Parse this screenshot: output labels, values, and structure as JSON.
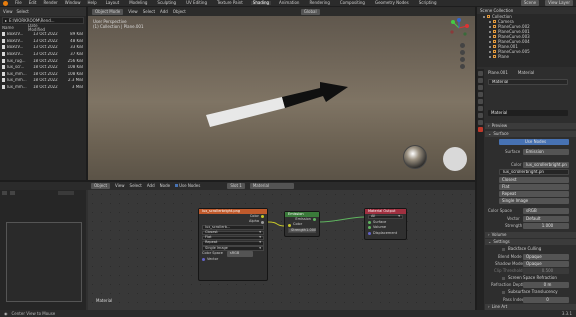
{
  "topbar": {
    "menu": [
      "File",
      "Edit",
      "Render",
      "Window",
      "Help"
    ],
    "workspaces": [
      "Layout",
      "Modeling",
      "Sculpting",
      "UV Editing",
      "Texture Paint",
      "Shading",
      "Animation",
      "Rendering",
      "Compositing",
      "Geometry Nodes",
      "Scripting"
    ],
    "active_workspace": "Shading",
    "scene": "Scene",
    "view_layer": "View Layer"
  },
  "filebrowser": {
    "menu": [
      "View",
      "Select"
    ],
    "path": "E:\\WORKROOM\\Rend...",
    "col_name": "Name",
    "col_date": "Date Modified",
    "files": [
      {
        "name": "BoxUV...",
        "date": "13 Oct 2022 00:10",
        "size": "89 KiB"
      },
      {
        "name": "BoxUV...",
        "date": "13 Oct 2022 00:10",
        "size": "48 KiB"
      },
      {
        "name": "BoxUV...",
        "date": "13 Oct 2022 00:10",
        "size": "33 KiB"
      },
      {
        "name": "BoxUV...",
        "date": "13 Oct 2022 00:10",
        "size": "37 KiB"
      },
      {
        "name": "lux_rug...",
        "date": "18 Oct 2022 18:15",
        "size": "256 KiB"
      },
      {
        "name": "lux_scr...",
        "date": "18 Oct 2022 18:15",
        "size": "108 KiB"
      },
      {
        "name": "lux_mm...",
        "date": "18 Oct 2022 18:15",
        "size": "108 KiB"
      },
      {
        "name": "lux_mm...",
        "date": "18 Oct 2022 03:15",
        "size": "2.3 MiB"
      },
      {
        "name": "lux_mm...",
        "date": "18 Oct 2022 03:15",
        "size": "3 MiB"
      }
    ]
  },
  "viewport": {
    "mode": "Object Mode",
    "menu": [
      "View",
      "Select",
      "Add",
      "Object"
    ],
    "shading": "Global",
    "view_name": "User Perspective",
    "collection": "(1) Collection | Plane.001"
  },
  "node_editor": {
    "mode": "Object",
    "menu": [
      "View",
      "Select",
      "Add",
      "Node"
    ],
    "use_nodes": "Use Nodes",
    "slot": "Slot 1",
    "material": "Material",
    "frame_label": "Material",
    "img_node": {
      "title": "lux_scrollerbright.png",
      "out_color": "Color",
      "out_alpha": "Alpha",
      "image": "lux_scrollerb...",
      "interp": "Closest",
      "proj": "Flat",
      "ext": "Repeat",
      "source": "Single Image",
      "cs_label": "Color Space",
      "cs": "sRGB",
      "vector": "Vector"
    },
    "emission_node": {
      "title": "Emission",
      "out": "Emission",
      "in_color": "Color",
      "strength_label": "Strength",
      "strength": "1.000"
    },
    "output_node": {
      "title": "Material Output",
      "target": "All",
      "in_surface": "Surface",
      "in_volume": "Volume",
      "in_disp": "Displacement"
    }
  },
  "outliner": {
    "title": "Scene Collection",
    "items": [
      "Collection",
      "Camera",
      "PlaneCurve.002",
      "PlaneCurve.001",
      "PlaneCurve.003",
      "PlaneCurve.004",
      "Plane.001",
      "PlaneCurve.005",
      "Plane"
    ]
  },
  "properties": {
    "object": "Plane.001",
    "material_tab": "Material",
    "slot": "Material",
    "mat_name": "Material",
    "preview": "Preview",
    "surface": "Surface",
    "use_nodes": "Use Nodes",
    "surface_label": "Surface",
    "surface_value": "Emission",
    "color_label": "Color",
    "image": "lux_scrollerbright.pn",
    "color_space_label": "Color Space",
    "color_space": "sRGB",
    "closest": "Closest",
    "flat": "Flat",
    "repeat": "Repeat",
    "single": "Single Image",
    "vector_label": "Vector",
    "vector": "Default",
    "strength_label": "Strength",
    "strength": "1.000",
    "volume": "Volume",
    "settings": "Settings",
    "backface": "Backface Culling",
    "blend_label": "Blend Mode",
    "blend": "Opaque",
    "shadow_label": "Shadow Mode",
    "shadow": "Opaque",
    "clip_label": "Clip Threshold",
    "clip": "0.500",
    "ssr": "Screen Space Refraction",
    "refr_label": "Refraction Depth",
    "refr": "0 m",
    "sss": "Subsurface Translucency",
    "pass_label": "Pass Index",
    "pass": "0",
    "lineart": "Line Art"
  },
  "status": {
    "text": "Center View to Mouse",
    "version": "3.3.1"
  },
  "colors": {
    "accent": "#4772b3",
    "image_header": "#bf5a2c",
    "emission_header": "#3a7a3a",
    "output_header": "#a03040",
    "brand": "#e87d0d"
  }
}
